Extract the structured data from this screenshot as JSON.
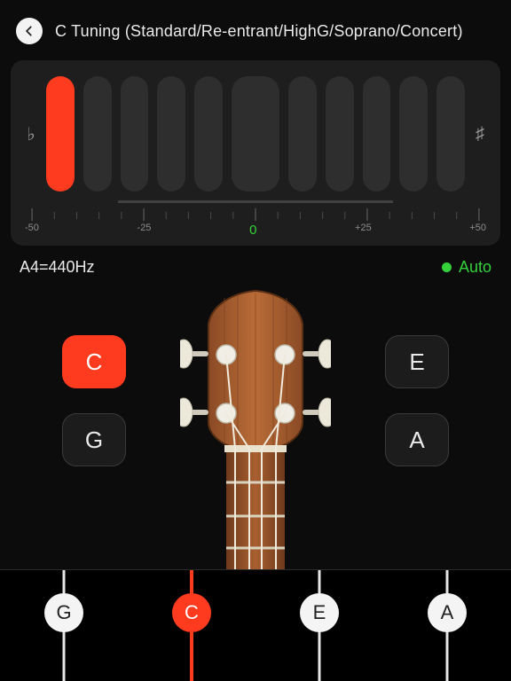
{
  "header": {
    "title": "C Tuning (Standard/Re-entrant/HighG/Soprano/Concert)"
  },
  "meter": {
    "flat_symbol": "♭",
    "sharp_symbol": "♯",
    "active_bar_index": 0,
    "scale_labels": {
      "min": "-50",
      "q1": "-25",
      "zero": "0",
      "q3": "+25",
      "max": "+50"
    }
  },
  "status": {
    "reference": "A4=440Hz",
    "auto_label": "Auto",
    "auto_on": true
  },
  "note_buttons": {
    "top_left": {
      "label": "C",
      "active": true
    },
    "top_right": {
      "label": "E",
      "active": false
    },
    "bot_left": {
      "label": "G",
      "active": false
    },
    "bot_right": {
      "label": "A",
      "active": false
    }
  },
  "strings": [
    {
      "label": "G",
      "active": false
    },
    {
      "label": "C",
      "active": true
    },
    {
      "label": "E",
      "active": false
    },
    {
      "label": "A",
      "active": false
    }
  ],
  "colors": {
    "accent": "#ff3b1f",
    "success": "#35d13a"
  }
}
